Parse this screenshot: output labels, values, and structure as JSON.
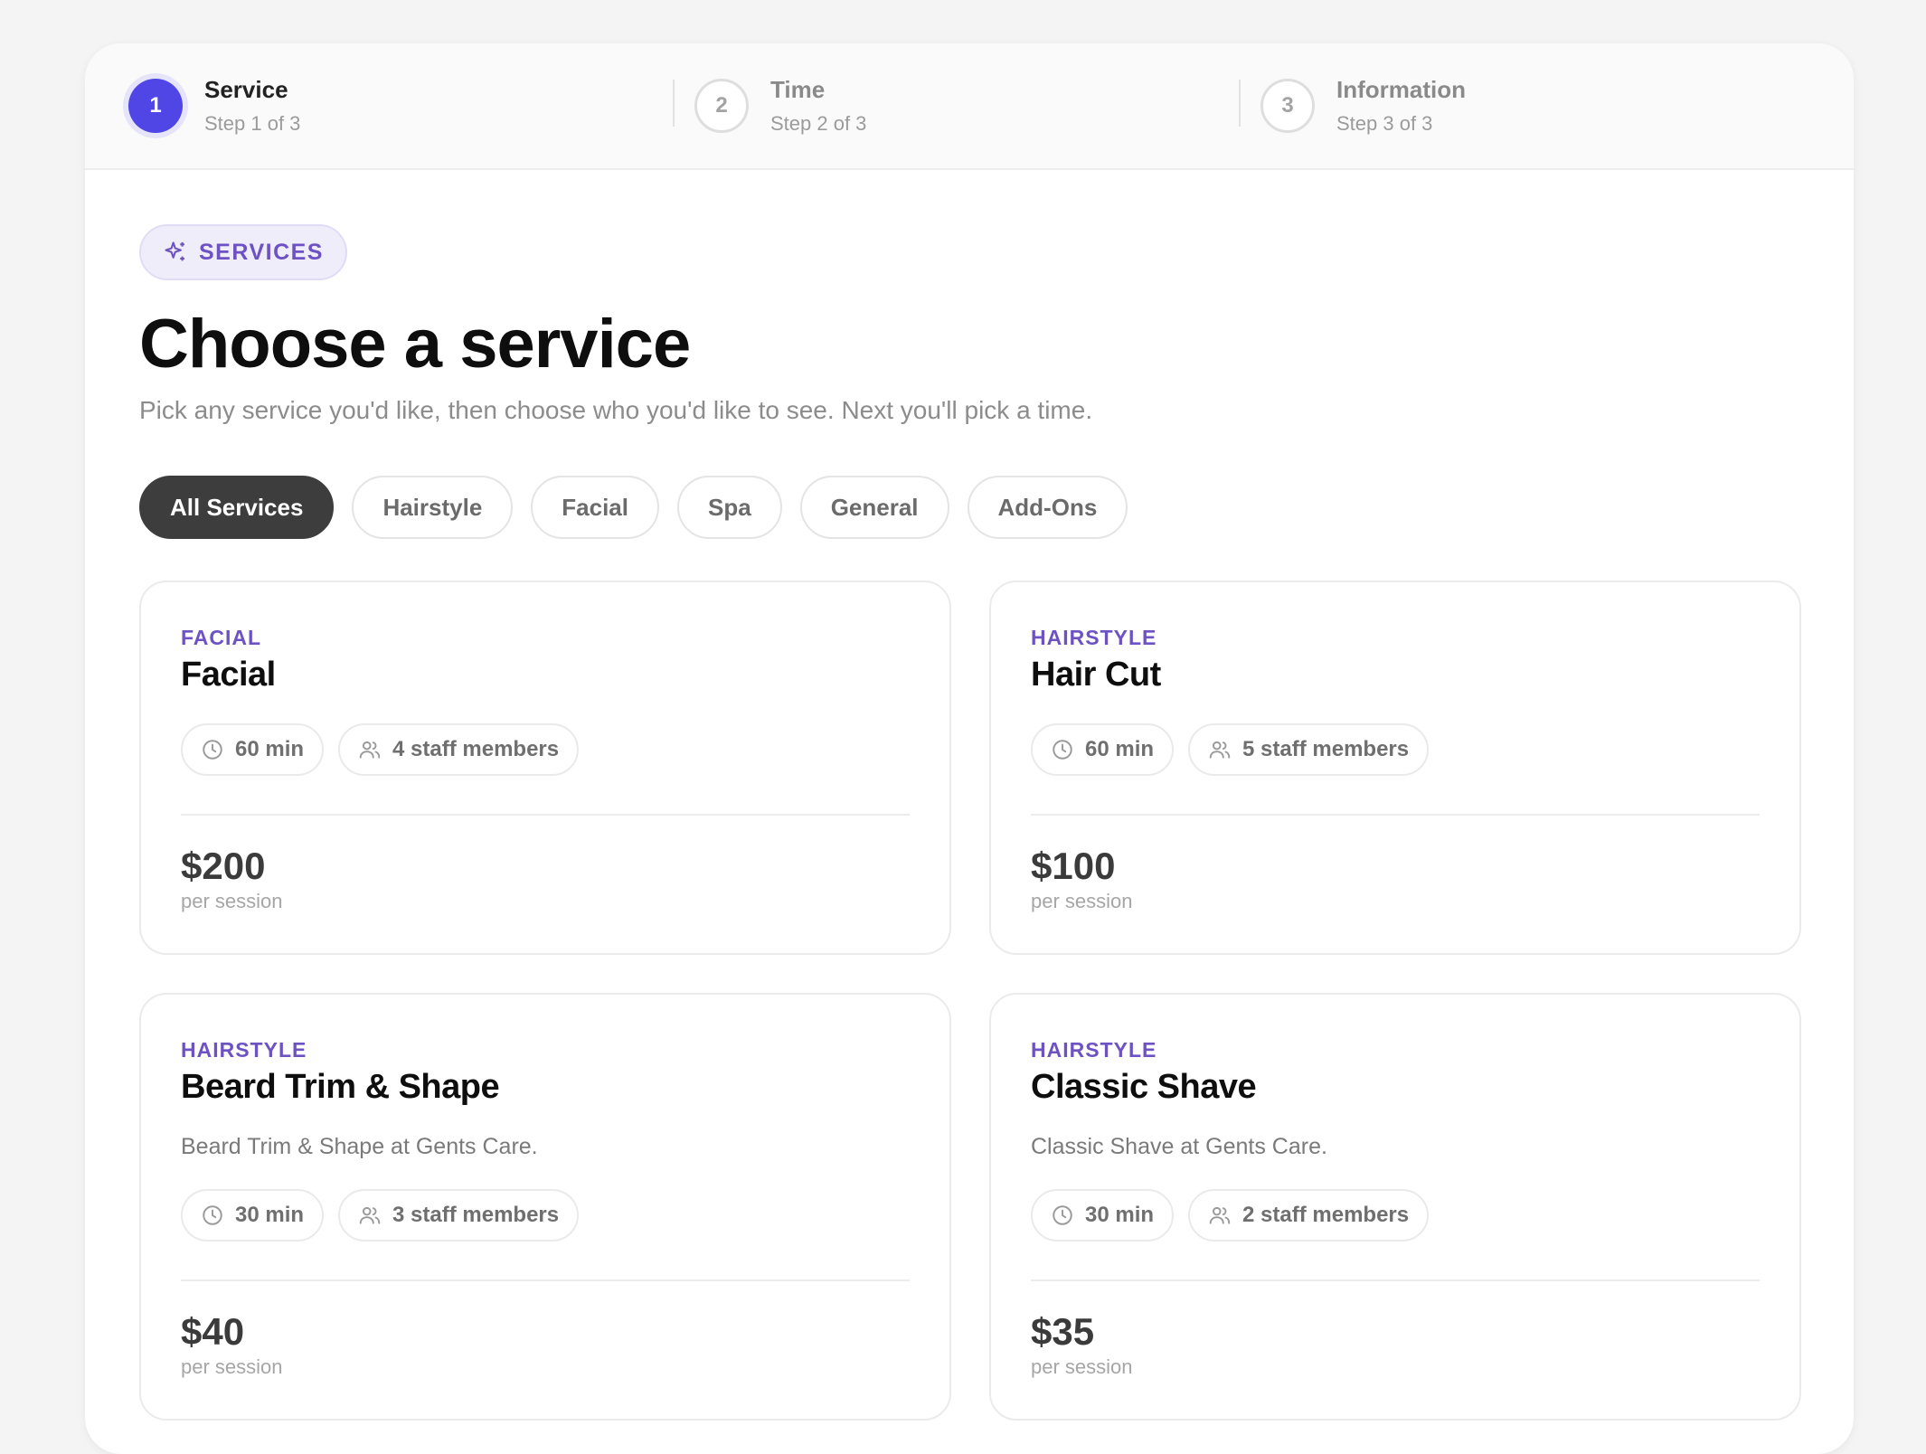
{
  "stepper": {
    "steps": [
      {
        "number": "1",
        "title": "Service",
        "subtitle": "Step 1 of 3"
      },
      {
        "number": "2",
        "title": "Time",
        "subtitle": "Step 2 of 3"
      },
      {
        "number": "3",
        "title": "Information",
        "subtitle": "Step 3 of 3"
      }
    ]
  },
  "header": {
    "badge": "SERVICES",
    "badge_icon": "sparkle-icon",
    "title": "Choose a service",
    "subtitle": "Pick any service you'd like, then choose who you'd like to see. Next you'll pick a time."
  },
  "filters": [
    "All Services",
    "Hairstyle",
    "Facial",
    "Spa",
    "General",
    "Add-Ons"
  ],
  "active_filter": "All Services",
  "services": [
    {
      "category": "FACIAL",
      "name": "Facial",
      "duration": "60 min",
      "staff": "4 staff members",
      "price": "$200",
      "price_unit": "per session"
    },
    {
      "category": "HAIRSTYLE",
      "name": "Hair Cut",
      "duration": "60 min",
      "staff": "5 staff members",
      "price": "$100",
      "price_unit": "per session"
    },
    {
      "category": "HAIRSTYLE",
      "name": "Beard Trim & Shape",
      "description": "Beard Trim & Shape at Gents Care.",
      "duration": "30 min",
      "staff": "3 staff members",
      "price": "$40",
      "price_unit": "per session"
    },
    {
      "category": "HAIRSTYLE",
      "name": "Classic Shave",
      "description": "Classic Shave at Gents Care.",
      "duration": "30 min",
      "staff": "2 staff members",
      "price": "$35",
      "price_unit": "per session"
    }
  ],
  "colors": {
    "accent": "#4f46e5",
    "category": "#6d52c3",
    "active_chip": "#3d3d3d",
    "background": "#f4f4f5"
  }
}
